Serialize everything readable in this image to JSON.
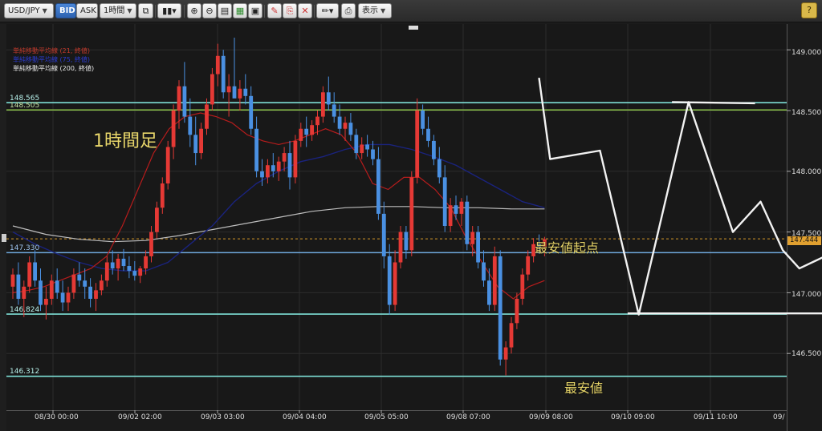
{
  "toolbar": {
    "symbol": "USD/JPY",
    "bid": "BID",
    "ask": "ASK",
    "timeframe": "1時間",
    "display": "表示",
    "help": "?"
  },
  "legend": [
    {
      "text": "単純移動平均線 (21, 終値)",
      "color": "#c0392b"
    },
    {
      "text": "単純移動平均線 (75, 終値)",
      "color": "#2b3bd0"
    },
    {
      "text": "単純移動平均線 (200, 終値)",
      "color": "#e8e8e8"
    }
  ],
  "annotations": {
    "timeframe_label": "1時間足",
    "low_start_label": "最安値起点",
    "low_label": "最安値"
  },
  "levels": [
    {
      "price": "148.565",
      "color": "#7ee0d6"
    },
    {
      "price": "148.505",
      "color": "#8bc34a"
    },
    {
      "price": "147.330",
      "color": "#6fa8dc"
    },
    {
      "price": "146.824",
      "color": "#7ee0d6"
    },
    {
      "price": "146.312",
      "color": "#7ee0d6"
    }
  ],
  "current_price": "147.444",
  "y_axis": [
    "149.000",
    "148.500",
    "148.000",
    "147.500",
    "147.000",
    "146.500"
  ],
  "x_axis": [
    "08/30 00:00",
    "09/02 02:00",
    "09/03 03:00",
    "09/04 04:00",
    "09/05 05:00",
    "09/08 07:00",
    "09/09 08:00",
    "09/10 09:00",
    "09/11 10:00",
    "09/"
  ],
  "chart_data": {
    "type": "candlestick",
    "ylim": [
      146.1,
      149.2
    ],
    "colors": {
      "up": "#e53935",
      "down": "#4a90e2",
      "ma21": "#b71c1c",
      "ma75": "#1a237e",
      "ma200": "#bdbdbd",
      "trend": "#f2f2f2"
    },
    "candles": [
      [
        147.05,
        147.2,
        146.95,
        147.15
      ],
      [
        147.15,
        147.25,
        146.9,
        146.95
      ],
      [
        146.95,
        147.1,
        146.8,
        147.05
      ],
      [
        147.05,
        147.3,
        147.0,
        147.25
      ],
      [
        147.25,
        147.35,
        147.05,
        147.1
      ],
      [
        147.1,
        147.2,
        146.85,
        146.9
      ],
      [
        146.9,
        147.05,
        146.78,
        146.95
      ],
      [
        146.95,
        147.15,
        146.9,
        147.1
      ],
      [
        147.1,
        147.2,
        146.95,
        147.0
      ],
      [
        147.0,
        147.1,
        146.85,
        146.92
      ],
      [
        146.92,
        147.05,
        146.85,
        147.0
      ],
      [
        147.0,
        147.2,
        146.95,
        147.15
      ],
      [
        147.15,
        147.25,
        147.05,
        147.1
      ],
      [
        147.1,
        147.2,
        146.95,
        147.05
      ],
      [
        147.05,
        147.12,
        146.88,
        146.95
      ],
      [
        146.95,
        147.08,
        146.85,
        147.02
      ],
      [
        147.02,
        147.15,
        146.98,
        147.1
      ],
      [
        147.1,
        147.3,
        147.05,
        147.25
      ],
      [
        147.25,
        147.35,
        147.15,
        147.2
      ],
      [
        147.2,
        147.32,
        147.1,
        147.28
      ],
      [
        147.28,
        147.36,
        147.18,
        147.22
      ],
      [
        147.22,
        147.3,
        147.12,
        147.18
      ],
      [
        147.18,
        147.26,
        147.1,
        147.14
      ],
      [
        147.14,
        147.22,
        147.08,
        147.2
      ],
      [
        147.2,
        147.35,
        147.15,
        147.3
      ],
      [
        147.3,
        147.55,
        147.25,
        147.5
      ],
      [
        147.5,
        147.75,
        147.45,
        147.7
      ],
      [
        147.7,
        147.95,
        147.65,
        147.9
      ],
      [
        147.9,
        148.25,
        147.85,
        148.2
      ],
      [
        148.2,
        148.55,
        148.1,
        148.5
      ],
      [
        148.5,
        148.75,
        148.35,
        148.7
      ],
      [
        148.7,
        148.9,
        148.4,
        148.45
      ],
      [
        148.45,
        148.6,
        148.2,
        148.3
      ],
      [
        148.3,
        148.45,
        148.05,
        148.15
      ],
      [
        148.15,
        148.4,
        148.1,
        148.35
      ],
      [
        148.35,
        148.6,
        148.3,
        148.55
      ],
      [
        148.55,
        148.85,
        148.5,
        148.8
      ],
      [
        148.8,
        149.05,
        148.7,
        148.95
      ],
      [
        148.95,
        149.0,
        148.6,
        148.65
      ],
      [
        148.65,
        148.8,
        148.45,
        148.7
      ],
      [
        148.7,
        149.1,
        148.65,
        148.6
      ],
      [
        148.6,
        148.75,
        148.5,
        148.68
      ],
      [
        148.68,
        148.8,
        148.55,
        148.62
      ],
      [
        148.62,
        148.7,
        148.3,
        148.35
      ],
      [
        148.35,
        148.45,
        147.95,
        148.0
      ],
      [
        148.0,
        148.1,
        147.88,
        147.95
      ],
      [
        147.95,
        148.1,
        147.9,
        148.05
      ],
      [
        148.05,
        148.15,
        147.95,
        148.0
      ],
      [
        148.0,
        148.12,
        147.92,
        148.08
      ],
      [
        148.08,
        148.2,
        148.0,
        148.15
      ],
      [
        148.15,
        148.25,
        147.85,
        147.95
      ],
      [
        147.95,
        148.3,
        147.9,
        148.25
      ],
      [
        148.25,
        148.4,
        148.2,
        148.35
      ],
      [
        148.35,
        148.45,
        148.2,
        148.3
      ],
      [
        148.3,
        148.42,
        148.25,
        148.38
      ],
      [
        148.38,
        148.5,
        148.3,
        148.45
      ],
      [
        148.45,
        148.7,
        148.4,
        148.65
      ],
      [
        148.65,
        148.78,
        148.5,
        148.55
      ],
      [
        148.55,
        148.65,
        148.4,
        148.45
      ],
      [
        148.45,
        148.55,
        148.3,
        148.35
      ],
      [
        148.35,
        148.45,
        148.25,
        148.4
      ],
      [
        148.4,
        148.48,
        148.25,
        148.3
      ],
      [
        148.3,
        148.35,
        148.1,
        148.15
      ],
      [
        148.15,
        148.28,
        148.1,
        148.22
      ],
      [
        148.22,
        148.3,
        148.12,
        148.18
      ],
      [
        148.18,
        148.25,
        148.05,
        148.1
      ],
      [
        148.1,
        148.2,
        147.6,
        147.65
      ],
      [
        147.65,
        147.75,
        147.2,
        147.3
      ],
      [
        147.3,
        147.4,
        146.82,
        146.9
      ],
      [
        146.9,
        147.35,
        146.85,
        147.25
      ],
      [
        147.25,
        147.55,
        147.2,
        147.5
      ],
      [
        147.5,
        147.55,
        147.28,
        147.35
      ],
      [
        147.35,
        148.0,
        147.3,
        147.95
      ],
      [
        147.95,
        148.6,
        147.9,
        148.5
      ],
      [
        148.5,
        148.55,
        148.3,
        148.35
      ],
      [
        148.35,
        148.45,
        148.2,
        148.25
      ],
      [
        148.25,
        148.3,
        148.05,
        148.1
      ],
      [
        148.1,
        148.2,
        147.9,
        147.95
      ],
      [
        147.95,
        148.05,
        147.5,
        147.55
      ],
      [
        147.55,
        147.78,
        147.5,
        147.72
      ],
      [
        147.72,
        147.8,
        147.6,
        147.65
      ],
      [
        147.65,
        147.78,
        147.55,
        147.75
      ],
      [
        147.75,
        147.8,
        147.35,
        147.4
      ],
      [
        147.4,
        147.55,
        147.3,
        147.5
      ],
      [
        147.5,
        147.55,
        147.2,
        147.25
      ],
      [
        147.25,
        147.35,
        147.05,
        147.1
      ],
      [
        147.1,
        147.2,
        146.85,
        146.9
      ],
      [
        146.9,
        147.38,
        146.85,
        147.3
      ],
      [
        147.3,
        147.35,
        146.4,
        146.45
      ],
      [
        146.45,
        146.6,
        146.32,
        146.55
      ],
      [
        146.55,
        146.8,
        146.5,
        146.75
      ],
      [
        146.75,
        147.0,
        146.7,
        146.95
      ],
      [
        146.95,
        147.2,
        146.9,
        147.15
      ],
      [
        147.15,
        147.35,
        147.1,
        147.3
      ],
      [
        147.3,
        147.45,
        147.25,
        147.4
      ],
      [
        147.4,
        147.48,
        147.32,
        147.38
      ],
      [
        147.38,
        147.46,
        147.3,
        147.44
      ]
    ],
    "ma21": [
      147.0,
      147.02,
      147.05,
      147.1,
      147.15,
      147.2,
      147.3,
      147.55,
      147.85,
      148.15,
      148.35,
      148.45,
      148.48,
      148.45,
      148.4,
      148.3,
      148.25,
      148.22,
      148.25,
      148.3,
      148.35,
      148.3,
      148.15,
      147.9,
      147.85,
      147.95,
      147.95,
      147.85,
      147.7,
      147.45,
      147.25,
      147.05,
      146.95,
      147.05,
      147.1
    ],
    "ma75": [
      147.5,
      147.4,
      147.32,
      147.25,
      147.2,
      147.18,
      147.18,
      147.25,
      147.4,
      147.55,
      147.75,
      147.9,
      148.0,
      148.08,
      148.12,
      148.18,
      148.22,
      148.22,
      148.18,
      148.12,
      148.05,
      147.95,
      147.85,
      147.75,
      147.7
    ],
    "ma200": [
      147.55,
      147.48,
      147.44,
      147.42,
      147.43,
      147.47,
      147.52,
      147.57,
      147.62,
      147.67,
      147.7,
      147.71,
      147.71,
      147.7,
      147.7,
      147.69,
      147.69
    ],
    "trend_lines": [
      [
        [
          95,
          148.77
        ],
        [
          97,
          148.1
        ],
        [
          106,
          148.17
        ],
        [
          113,
          146.82
        ],
        [
          122,
          148.57
        ],
        [
          130,
          147.5
        ],
        [
          135,
          147.75
        ],
        [
          139,
          147.35
        ],
        [
          142,
          147.2
        ],
        [
          148,
          147.33
        ],
        [
          149,
          146.82
        ],
        [
          151,
          147.33
        ]
      ],
      [
        [
          119,
          148.57
        ],
        [
          134,
          148.56
        ]
      ],
      [
        [
          111,
          146.83
        ],
        [
          148,
          146.83
        ]
      ],
      [
        [
          150,
          146.31
        ],
        [
          176,
          146.31
        ]
      ],
      [
        [
          148,
          147.33
        ],
        [
          182,
          147.33
        ]
      ]
    ]
  }
}
